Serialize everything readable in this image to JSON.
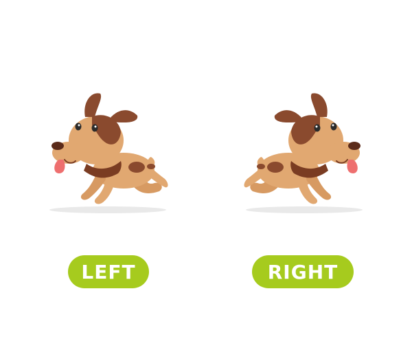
{
  "colors": {
    "background": "#ffffff",
    "pill": "#a6cb1e",
    "label": "#ffffff",
    "dog_body": "#e1a871",
    "dog_spots": "#8a4a2e",
    "dog_collar": "#7a3c22",
    "dog_tongue": "#ee6f6f",
    "shadow": "#e9e9e9"
  },
  "left": {
    "label": "LEFT",
    "illustration": "puppy-facing-left"
  },
  "right": {
    "label": "RIGHT",
    "illustration": "puppy-facing-right"
  }
}
